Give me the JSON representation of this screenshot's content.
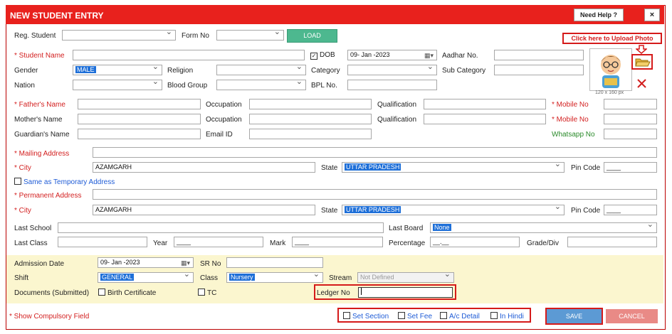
{
  "window": {
    "title": "NEW STUDENT ENTRY",
    "help_label": "Need Help ?",
    "close_label": "×"
  },
  "top": {
    "reg_student_label": "Reg. Student",
    "form_no_label": "Form No",
    "load_label": "LOAD",
    "upload_photo_note": "Click here to Upload Photo",
    "photo_caption": "120 x 160 px"
  },
  "student": {
    "name_label": "* Student Name",
    "dob_label": "DOB",
    "dob_value": "09- Jan -2023",
    "aadhar_label": "Aadhar No.",
    "gender_label": "Gender",
    "gender_value": "MALE",
    "religion_label": "Religion",
    "category_label": "Category",
    "sub_category_label": "Sub Category",
    "nation_label": "Nation",
    "blood_group_label": "Blood Group",
    "bpl_label": "BPL No."
  },
  "parents": {
    "father_label": "* Father's Name",
    "mother_label": "Mother's Name",
    "guardian_label": "Guardian's Name",
    "occupation_label": "Occupation",
    "email_label": "Email ID",
    "qualification_label": "Qualification",
    "mobile_label": "* Mobile  No",
    "mobile2_label": "* Mobile No",
    "whatsapp_label": "Whatsapp No"
  },
  "mailing": {
    "address_label": "* Mailing Address",
    "city_label": "* City",
    "city_value": "AZAMGARH",
    "state_label": "State",
    "state_value": "UTTAR PRADESH",
    "pin_label": "Pin Code",
    "pin_value": "____",
    "same_as_label": "Same as Temporary Address"
  },
  "permanent": {
    "address_label": "* Permanent Address",
    "city_label": "* City",
    "city_value": "AZAMGARH",
    "state_label": "State",
    "state_value": "UTTAR PRADESH",
    "pin_label": "Pin Code",
    "pin_value": "____"
  },
  "academic": {
    "last_school_label": "Last School",
    "last_board_label": "Last Board",
    "last_board_value": "None",
    "last_class_label": "Last Class",
    "year_label": "Year",
    "year_value": "____",
    "mark_label": "Mark",
    "mark_value": "____",
    "percentage_label": "Percentage",
    "percentage_value": "__.__",
    "grade_label": "Grade/Div"
  },
  "admission": {
    "date_label": "Admission Date",
    "date_value": "09- Jan -2023",
    "sr_no_label": "SR No",
    "shift_label": "Shift",
    "shift_value": "GENERAL",
    "class_label": "Class",
    "class_value": "Nursery",
    "stream_label": "Stream",
    "stream_value": "Not Defined",
    "documents_label": "Documents (Submitted)",
    "birth_cert_label": "Birth Certificate",
    "tc_label": "TC",
    "ledger_label": "Ledger No"
  },
  "footer": {
    "compulsory_note": "* Show Compulsory Field",
    "set_section": "Set Section",
    "set_fee": "Set Fee",
    "ac_detail": "A/c Detail",
    "in_hindi": "In Hindi",
    "save_label": "SAVE",
    "cancel_label": "CANCEL"
  }
}
